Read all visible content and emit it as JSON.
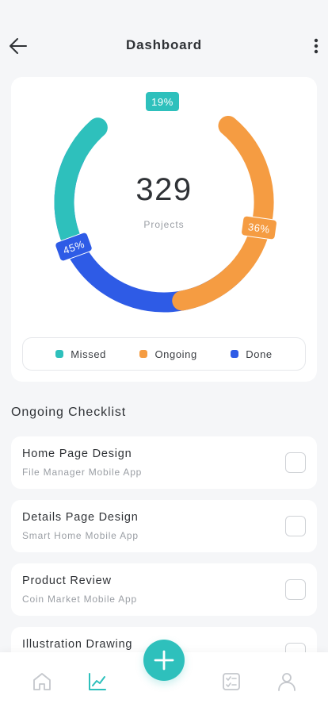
{
  "header": {
    "title": "Dashboard"
  },
  "summary": {
    "total": "329",
    "total_label": "Projects",
    "segments": [
      {
        "name": "Missed",
        "percent": 19,
        "label": "19%",
        "color": "#2ec0bc"
      },
      {
        "name": "Ongoing",
        "percent": 36,
        "label": "36%",
        "color": "#f59c42"
      },
      {
        "name": "Done",
        "percent": 45,
        "label": "45%",
        "color": "#2e5be6"
      }
    ]
  },
  "legend": [
    {
      "label": "Missed",
      "color": "#2ec0bc"
    },
    {
      "label": "Ongoing",
      "color": "#f59c42"
    },
    {
      "label": "Done",
      "color": "#2e5be6"
    }
  ],
  "checklist": {
    "title": "Ongoing Checklist",
    "items": [
      {
        "title": "Home Page Design",
        "subtitle": "File Manager Mobile App",
        "checked": false
      },
      {
        "title": "Details Page Design",
        "subtitle": "Smart Home Mobile App",
        "checked": false
      },
      {
        "title": "Product Review",
        "subtitle": "Coin Market Mobile App",
        "checked": false
      },
      {
        "title": "Illustration Drawing",
        "subtitle": "",
        "checked": false
      }
    ]
  },
  "tabbar": {
    "items": [
      {
        "icon": "home-icon",
        "active": false
      },
      {
        "icon": "chart-icon",
        "active": true
      },
      {
        "icon": "checklist-icon",
        "active": false
      },
      {
        "icon": "profile-icon",
        "active": false
      }
    ],
    "fab_icon": "plus-icon",
    "active_color": "#2ec0bc",
    "inactive_color": "#c4c7cc"
  }
}
